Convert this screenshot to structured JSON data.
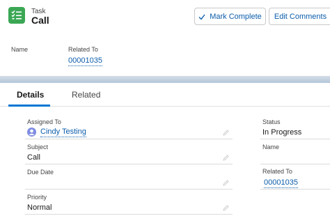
{
  "header": {
    "object_type": "Task",
    "title": "Call",
    "buttons": {
      "mark_complete": "Mark Complete",
      "edit_comments": "Edit Comments"
    },
    "fields": {
      "name_label": "Name",
      "related_label": "Related To",
      "related_value": "00001035"
    }
  },
  "tabs": {
    "details": "Details",
    "related": "Related"
  },
  "details": {
    "left": {
      "assigned_label": "Assigned To",
      "assigned_value": "Cindy Testing",
      "subject_label": "Subject",
      "subject_value": "Call",
      "due_label": "Due Date",
      "due_value": "",
      "priority_label": "Priority",
      "priority_value": "Normal"
    },
    "right": {
      "status_label": "Status",
      "status_value": "In Progress",
      "name_label": "Name",
      "name_value": "",
      "related_label": "Related To",
      "related_value": "00001035"
    }
  },
  "colors": {
    "brand_link": "#0b5cab",
    "tab_active": "#0176d3",
    "task_icon": "#3ba755"
  },
  "icons": {
    "task": "task-list-icon",
    "check": "check-icon",
    "edit": "pencil-icon",
    "user": "user-avatar-icon"
  }
}
